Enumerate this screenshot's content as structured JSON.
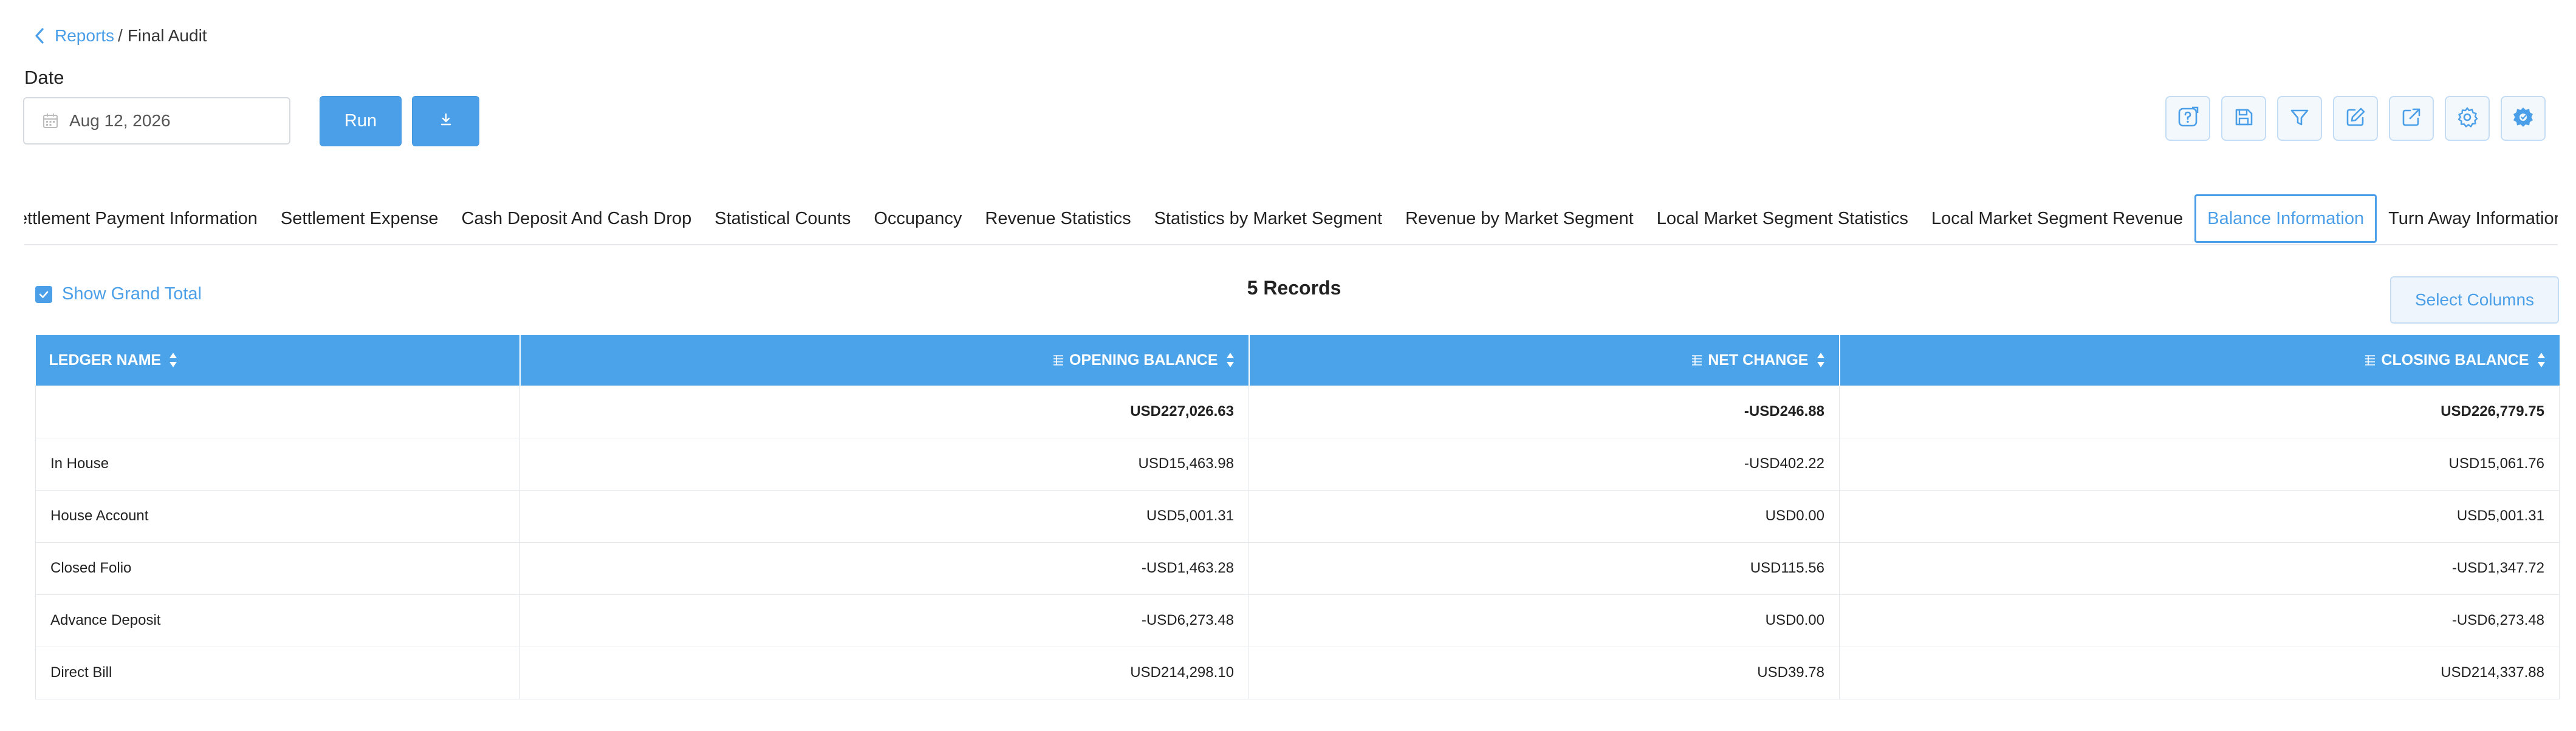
{
  "breadcrumb": {
    "parent": "Reports",
    "separator": "/",
    "current": "Final Audit"
  },
  "date": {
    "label": "Date",
    "value": "Aug 12, 2026"
  },
  "actions": {
    "run_label": "Run"
  },
  "toolbar": {
    "icons": [
      "help-icon",
      "save-icon",
      "filter-icon",
      "edit-icon",
      "export-icon",
      "settings-icon",
      "advanced-settings-icon"
    ]
  },
  "tabs": [
    {
      "label": "ettlement Payment Information"
    },
    {
      "label": "Settlement Expense"
    },
    {
      "label": "Cash Deposit And Cash Drop"
    },
    {
      "label": "Statistical Counts"
    },
    {
      "label": "Occupancy"
    },
    {
      "label": "Revenue Statistics"
    },
    {
      "label": "Statistics by Market Segment"
    },
    {
      "label": "Revenue by Market Segment"
    },
    {
      "label": "Local Market Segment Statistics"
    },
    {
      "label": "Local Market Segment Revenue"
    },
    {
      "label": "Balance Information",
      "active": true
    },
    {
      "label": "Turn Away Information"
    }
  ],
  "options": {
    "show_grand_total": "Show Grand Total",
    "show_grand_total_checked": true
  },
  "records": "5 Records",
  "select_columns": "Select Columns",
  "table": {
    "headers": [
      "LEDGER NAME",
      "OPENING BALANCE",
      "NET CHANGE",
      "CLOSING BALANCE"
    ],
    "total_row": [
      "",
      "USD227,026.63",
      "-USD246.88",
      "USD226,779.75"
    ],
    "rows": [
      [
        "In House",
        "USD15,463.98",
        "-USD402.22",
        "USD15,061.76"
      ],
      [
        "House Account",
        "USD5,001.31",
        "USD0.00",
        "USD5,001.31"
      ],
      [
        "Closed Folio",
        "-USD1,463.28",
        "USD115.56",
        "-USD1,347.72"
      ],
      [
        "Advance Deposit",
        "-USD6,273.48",
        "USD0.00",
        "-USD6,273.48"
      ],
      [
        "Direct Bill",
        "USD214,298.10",
        "USD39.78",
        "USD214,337.88"
      ]
    ]
  },
  "colors": {
    "accent": "#4a9fe8",
    "header_bg": "#4ba3ea"
  }
}
